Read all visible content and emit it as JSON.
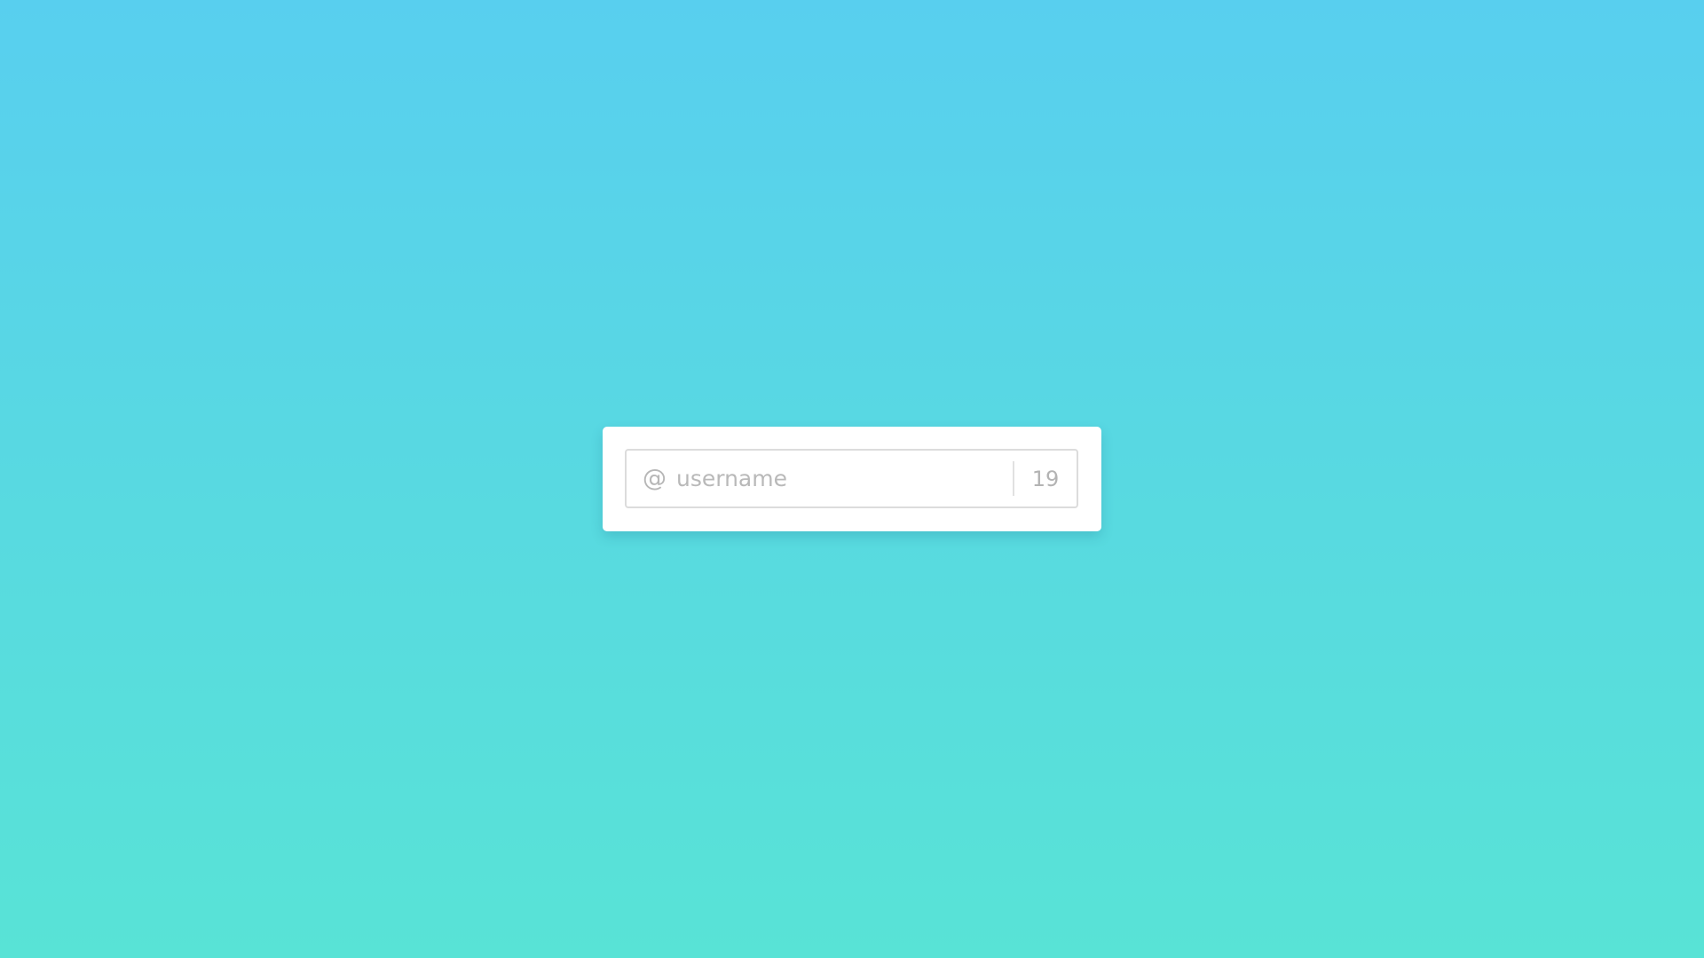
{
  "background": {
    "gradient_top": "#58CFEF",
    "gradient_bottom": "#58E3D6"
  },
  "username_field": {
    "icon": "at-sign-icon",
    "icon_glyph": "@",
    "value": "",
    "placeholder": "username",
    "remaining_chars": "19"
  }
}
